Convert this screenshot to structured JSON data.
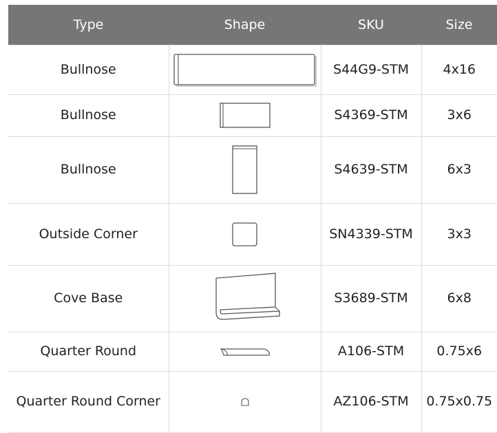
{
  "table": {
    "headers": [
      "Type",
      "Shape",
      "SKU",
      "Size"
    ],
    "rows": [
      {
        "type": "Bullnose",
        "shape_icon": "bullnose-4x16-shape-icon",
        "sku": "S44G9-STM",
        "size": "4x16"
      },
      {
        "type": "Bullnose",
        "shape_icon": "bullnose-3x6-shape-icon",
        "sku": "S4369-STM",
        "size": "3x6"
      },
      {
        "type": "Bullnose",
        "shape_icon": "bullnose-6x3-shape-icon",
        "sku": "S4639-STM",
        "size": "6x3"
      },
      {
        "type": "Outside Corner",
        "shape_icon": "outside-corner-shape-icon",
        "sku": "SN4339-STM",
        "size": "3x3"
      },
      {
        "type": "Cove Base",
        "shape_icon": "cove-base-shape-icon",
        "sku": "S3689-STM",
        "size": "6x8"
      },
      {
        "type": "Quarter Round",
        "shape_icon": "quarter-round-shape-icon",
        "sku": "A106-STM",
        "size": "0.75x6"
      },
      {
        "type": "Quarter Round Corner",
        "shape_icon": "quarter-round-corner-shape-icon",
        "sku": "AZ106-STM",
        "size": "0.75x0.75"
      }
    ]
  }
}
